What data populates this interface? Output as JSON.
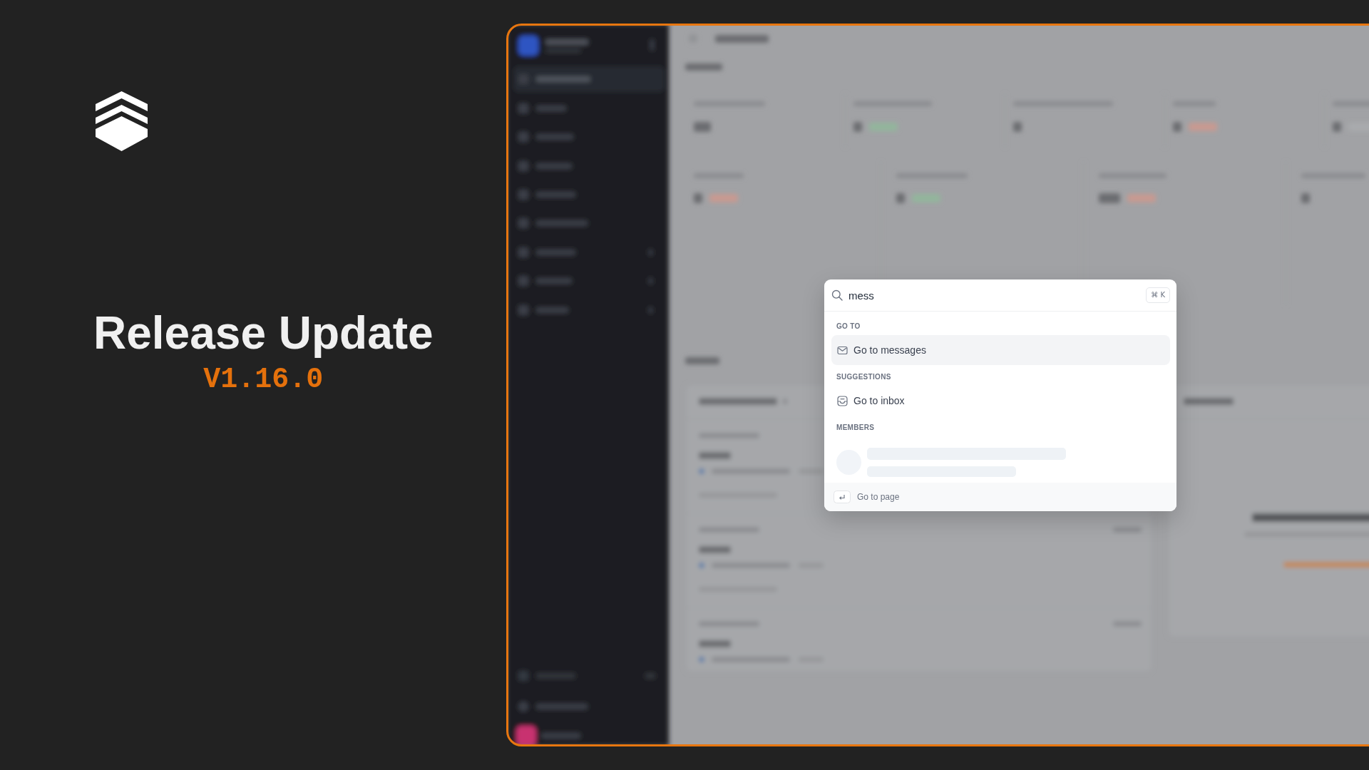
{
  "hero": {
    "title": "Release Update",
    "version": "V1.16.0"
  },
  "command_palette": {
    "search": {
      "value": "mess",
      "shortcut": "⌘ K"
    },
    "groups": [
      {
        "label": "GO TO",
        "loading": false,
        "items": [
          {
            "label": "Go to messages",
            "selected": true
          }
        ]
      },
      {
        "label": "SUGGESTIONS",
        "loading": false,
        "items": [
          {
            "label": "Go to inbox",
            "selected": false
          }
        ]
      },
      {
        "label": "MEMBERS",
        "loading": true
      }
    ],
    "footer": {
      "hint": "Go to page"
    }
  }
}
